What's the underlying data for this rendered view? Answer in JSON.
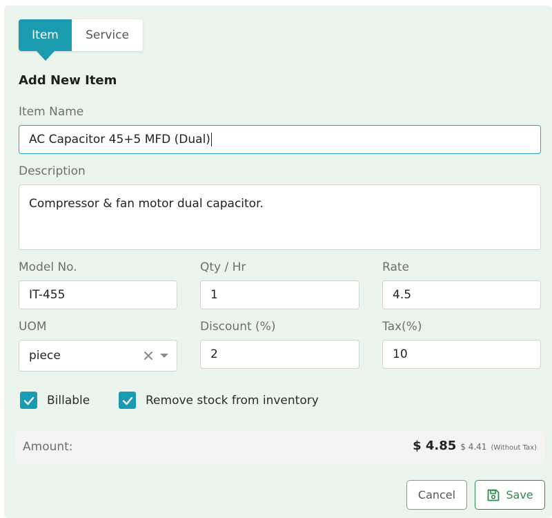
{
  "tabs": [
    {
      "label": "Item",
      "active": true
    },
    {
      "label": "Service",
      "active": false
    }
  ],
  "form": {
    "heading": "Add New Item",
    "item_name": {
      "label": "Item Name",
      "value": "AC Capacitor 45+5 MFD (Dual)"
    },
    "description": {
      "label": "Description",
      "value": "Compressor & fan motor dual capacitor."
    },
    "model_no": {
      "label": "Model No.",
      "value": "IT-455"
    },
    "qty_hr": {
      "label": "Qty / Hr",
      "value": "1"
    },
    "rate": {
      "label": "Rate",
      "value": "4.5"
    },
    "uom": {
      "label": "UOM",
      "value": "piece"
    },
    "discount": {
      "label": "Discount (%)",
      "value": "2"
    },
    "tax": {
      "label": "Tax(%)",
      "value": "10"
    }
  },
  "checkboxes": [
    {
      "label": "Billable",
      "checked": true
    },
    {
      "label": "Remove stock from inventory",
      "checked": true
    }
  ],
  "amount": {
    "label": "Amount:",
    "total": "$ 4.85",
    "without_tax_value": "$ 4.41",
    "without_tax_note": "(Without Tax)"
  },
  "buttons": {
    "cancel": "Cancel",
    "save": "Save"
  },
  "colors": {
    "accent": "#1a9bb0",
    "save_green": "#2e8a4f",
    "panel_bg": "#ebf5ee"
  },
  "icons": {
    "clear": "close-icon",
    "dropdown": "chevron-down-icon",
    "checkbox": "check-icon",
    "save": "save-icon"
  }
}
